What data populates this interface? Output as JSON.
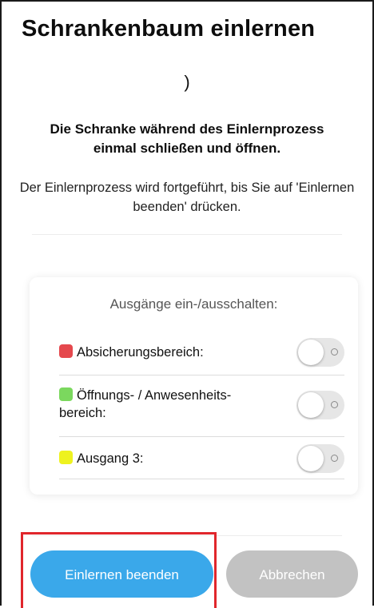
{
  "screen": {
    "title": "Schrankenbaum einlernen",
    "spinner_glyph": ")",
    "instruction": "Die Schranke während des Einlernprozess einmal schließen und öffnen.",
    "info": "Der Einlernprozess wird fortgeführt, bis Sie auf 'Einlernen beenden' drücken."
  },
  "outputs_card": {
    "heading": "Ausgänge ein-/ausschalten:",
    "rows": [
      {
        "label": "Absicherungsbereich:",
        "color": "#e5484d",
        "enabled": false
      },
      {
        "label": "Öffnungs- / Anwesenheits-bereich:",
        "color": "#7bd85e",
        "enabled": false
      },
      {
        "label": "Ausgang 3:",
        "color": "#eef21f",
        "enabled": false
      }
    ]
  },
  "actions": {
    "primary_label": "Einlernen beenden",
    "primary_color": "#3aa8ea",
    "secondary_label": "Abbrechen",
    "secondary_color": "#c2c2c2",
    "highlight_color": "#e0262c"
  }
}
